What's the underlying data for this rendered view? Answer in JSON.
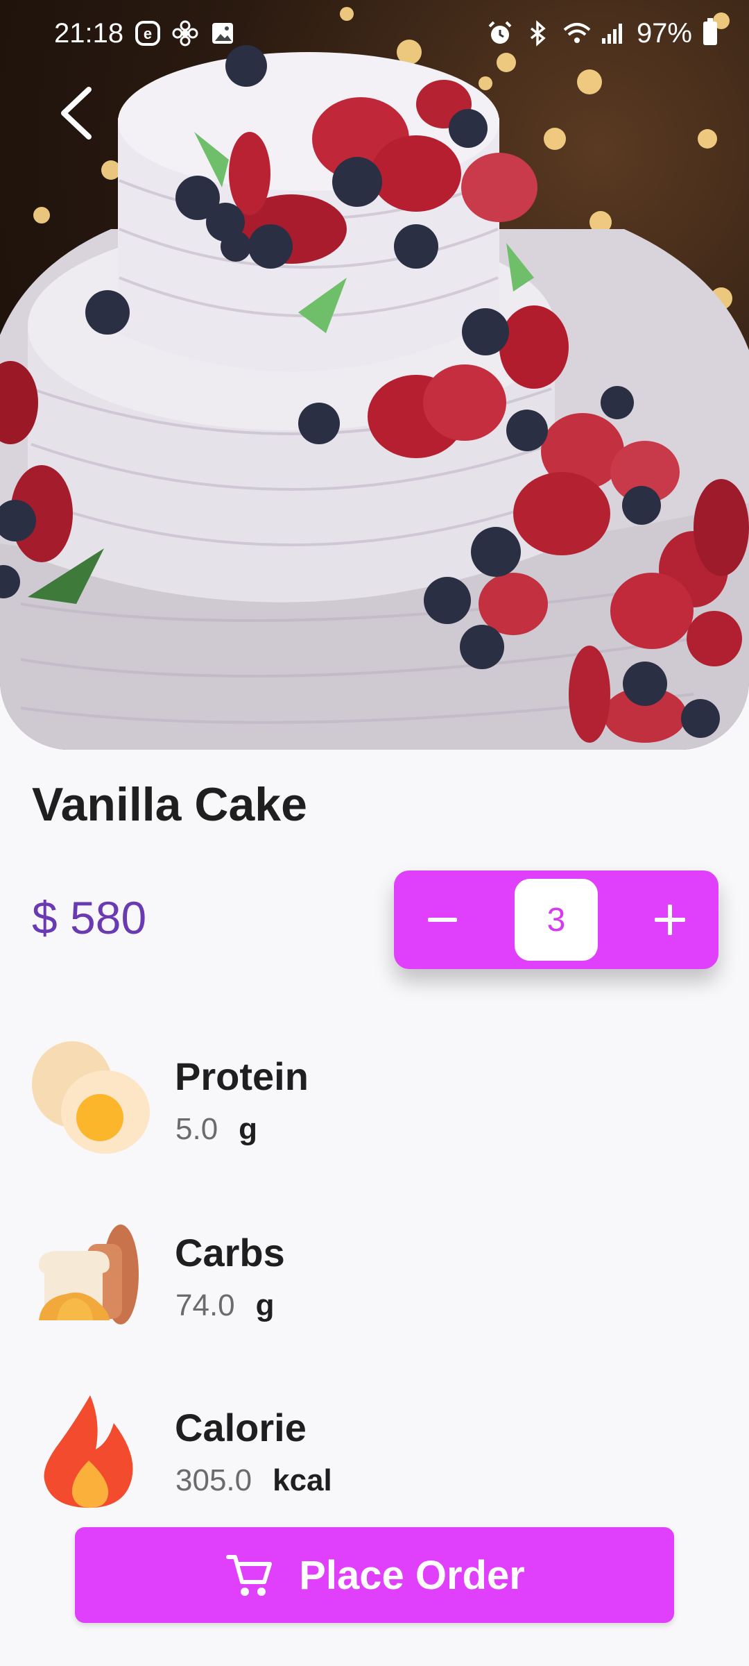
{
  "status_bar": {
    "time": "21:18",
    "battery": "97%",
    "left_icons": [
      "e-badge-icon",
      "fan-icon",
      "gallery-icon"
    ],
    "right_icons": [
      "alarm-icon",
      "bluetooth-icon",
      "wifi-icon",
      "signal-icon",
      "battery-icon"
    ]
  },
  "product": {
    "name": "Vanilla Cake",
    "price": "$ 580",
    "quantity": "3"
  },
  "nutrients": [
    {
      "name": "Protein",
      "value": "5.0",
      "unit": "g",
      "icon": "egg-icon"
    },
    {
      "name": "Carbs",
      "value": "74.0",
      "unit": "g",
      "icon": "bread-icon"
    },
    {
      "name": "Calorie",
      "value": "305.0",
      "unit": "kcal",
      "icon": "flame-icon"
    }
  ],
  "actions": {
    "place_order": "Place Order"
  },
  "colors": {
    "accent": "#e040fb",
    "price": "#6a3ab2",
    "background": "#f8f8fa"
  }
}
